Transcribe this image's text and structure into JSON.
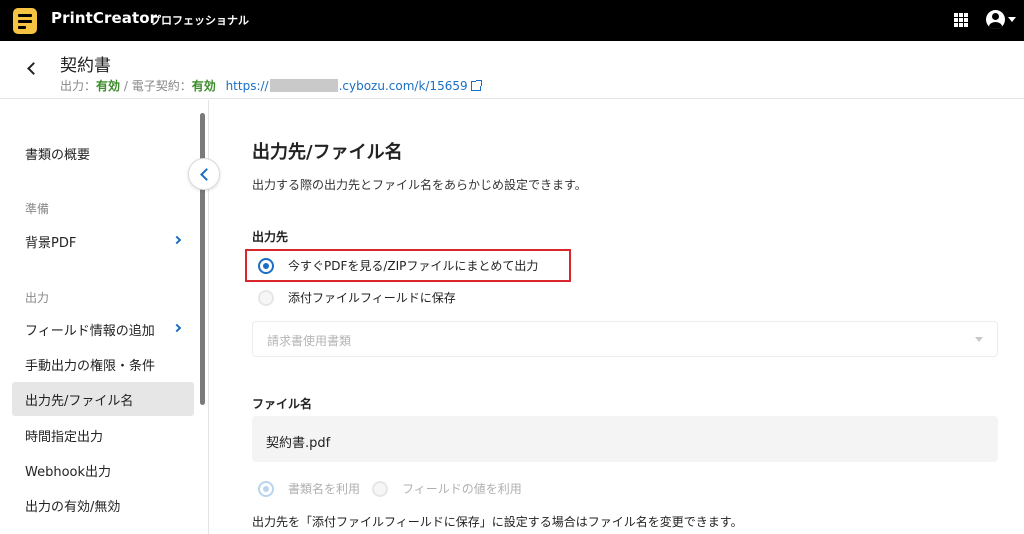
{
  "topbar": {
    "brand": "PrintCreator",
    "edition": "プロフェッショナル",
    "apps_icon": "grid-icon",
    "account_icon": "account-circle-icon"
  },
  "header": {
    "title": "契約書",
    "output_label": "出力：",
    "output_status": "有効",
    "separator": " / ",
    "esign_label": "電子契約：",
    "esign_status": "有効",
    "url_prefix": "https://",
    "url_suffix": ".cybozu.com/k/15659"
  },
  "sidebar": {
    "items": [
      {
        "label": "書類の概要"
      },
      {
        "section": "準備"
      },
      {
        "label": "背景PDF"
      },
      {
        "section": "出力"
      },
      {
        "label": "フィールド情報の追加"
      },
      {
        "label": "手動出力の権限・条件"
      },
      {
        "label": "出力先/ファイル名"
      },
      {
        "label": "時間指定出力"
      },
      {
        "label": "Webhook出力"
      },
      {
        "label": "出力の有効/無効"
      }
    ]
  },
  "main": {
    "title": "出力先/ファイル名",
    "description": "出力する際の出力先とファイル名をあらかじめ設定できます。",
    "destination": {
      "label": "出力先",
      "options": [
        {
          "label": "今すぐPDFを見る/ZIPファイルにまとめて出力",
          "selected": true
        },
        {
          "label": "添付ファイルフィールドに保存",
          "selected": false
        }
      ],
      "select_placeholder": "請求書使用書類"
    },
    "filename": {
      "label": "ファイル名",
      "value": "契約書.pdf",
      "options": [
        {
          "label": "書類名を利用",
          "selected": true
        },
        {
          "label": "フィールドの値を利用",
          "selected": false
        }
      ],
      "note": "出力先を「添付ファイルフィールドに保存」に設定する場合はファイル名を変更できます。"
    }
  },
  "colors": {
    "accent": "#1a6fc4",
    "status_ok": "#3b8d2a",
    "highlight": "#d9262c",
    "logo": "#f6c343"
  }
}
